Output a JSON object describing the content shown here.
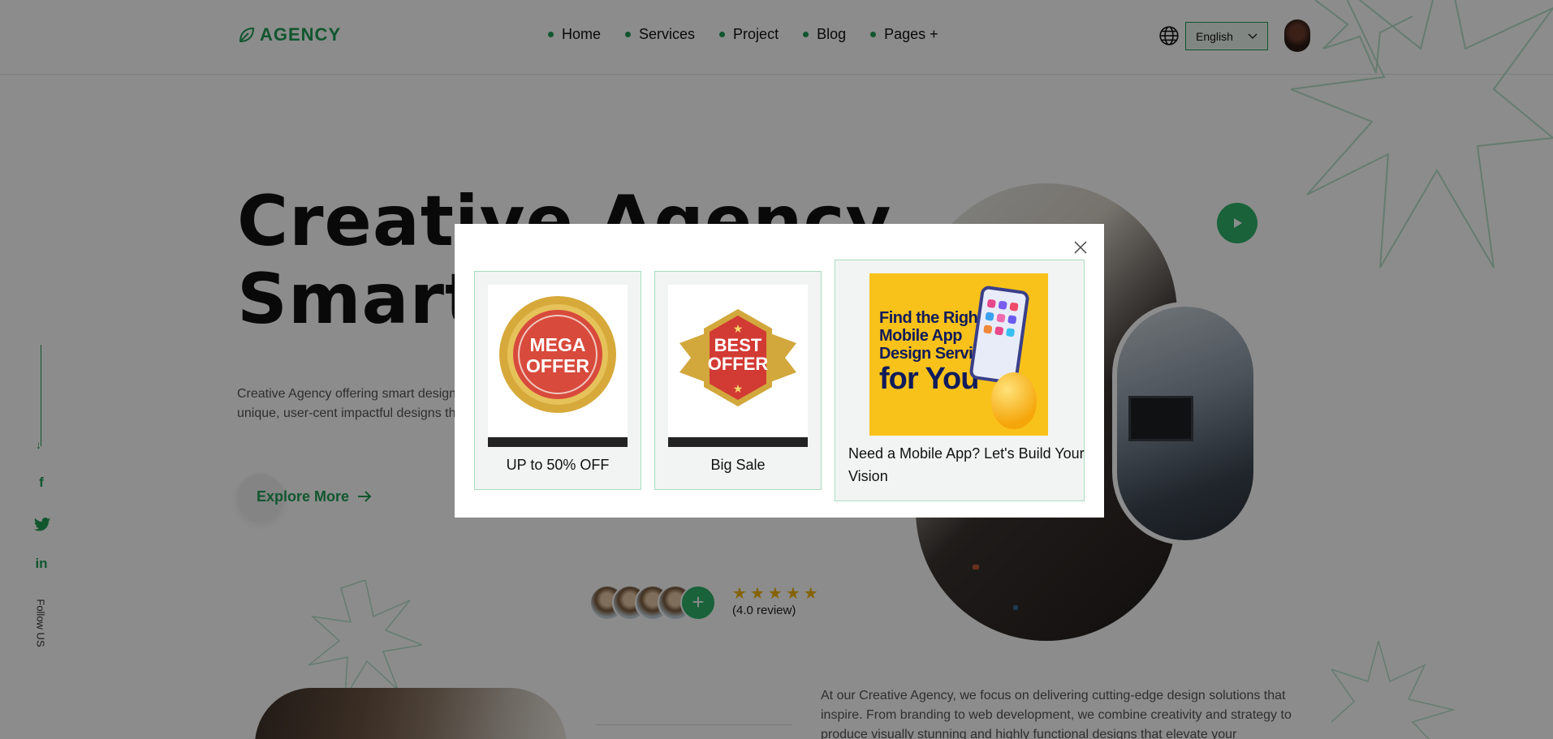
{
  "header": {
    "logo": "AGENCY",
    "nav": [
      {
        "label": "Home"
      },
      {
        "label": "Services"
      },
      {
        "label": "Project"
      },
      {
        "label": "Blog"
      },
      {
        "label": "Pages +"
      }
    ],
    "language": "English"
  },
  "hero": {
    "title_line1": "Creative Agency",
    "title_line2": "Smart",
    "description": "Creative Agency offering smart design specialize in crafting unique, user-cent impactful designs that drive success a",
    "explore_label": "Explore More"
  },
  "social": {
    "follow_label": "Follow US"
  },
  "reviews": {
    "rating": 5,
    "text": "(4.0 review)"
  },
  "about": {
    "text": "At our Creative Agency, we focus on delivering cutting-edge design solutions that inspire. From branding to web development, we combine creativity and strategy to produce visually stunning and highly functional designs that elevate your"
  },
  "modal": {
    "cards": [
      {
        "caption": "UP to 50% OFF",
        "badge_line1": "MEGA",
        "badge_line2": "OFFER"
      },
      {
        "caption": "Big Sale",
        "badge_line1": "BEST",
        "badge_line2": "OFFER"
      },
      {
        "caption": "Need a Mobile App? Let's Build Your Vision",
        "ad_line1": "Find the Right",
        "ad_line2": "Mobile App",
        "ad_line3": "Design Service",
        "ad_line4": "for You"
      }
    ]
  },
  "colors": {
    "accent": "#1f9d55",
    "play": "#2fb36a",
    "star": "#f0b400",
    "ad_bg": "#f8c21a",
    "ad_text": "#101b5c"
  },
  "icons": [
    "leaf-logo-icon",
    "globe-icon",
    "chevron-down-icon",
    "play-icon",
    "arrow-right-icon",
    "facebook-icon",
    "twitter-icon",
    "linkedin-icon",
    "plus-icon",
    "star-icon",
    "close-icon"
  ]
}
